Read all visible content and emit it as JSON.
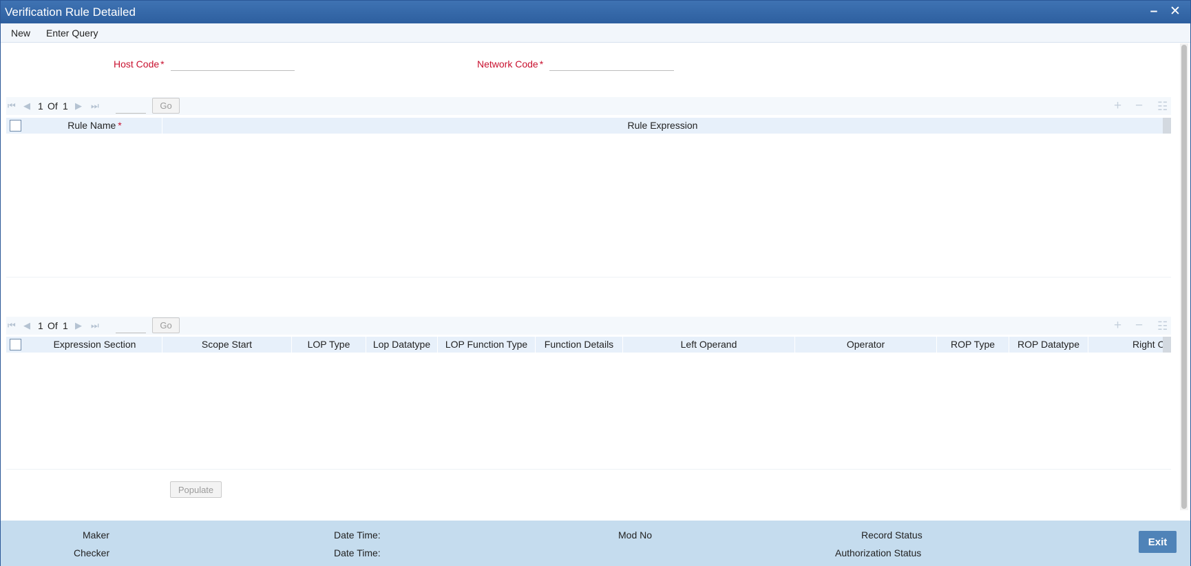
{
  "window": {
    "title": "Verification Rule Detailed",
    "minimize_glyph": "–",
    "close_glyph": "✕"
  },
  "menu": {
    "new_label": "New",
    "enter_query_label": "Enter Query"
  },
  "form": {
    "host_code_label": "Host Code",
    "network_code_label": "Network Code",
    "required_marker": "*",
    "host_code_value": "",
    "network_code_value": ""
  },
  "rules_grid": {
    "current_page": "1",
    "of_label": "Of",
    "total_pages": "1",
    "go_label": "Go",
    "columns": [
      "Rule Name",
      "Rule Expression"
    ],
    "required_marker": "*",
    "rows": []
  },
  "expression_grid": {
    "current_page": "1",
    "of_label": "Of",
    "total_pages": "1",
    "go_label": "Go",
    "columns": [
      "Expression Section",
      "Scope Start",
      "LOP Type",
      "Lop Datatype",
      "LOP Function Type",
      "Function Details",
      "Left Operand",
      "Operator",
      "ROP Type",
      "ROP Datatype",
      "Right Operand"
    ],
    "rows": []
  },
  "actions": {
    "populate_label": "Populate"
  },
  "footer": {
    "maker_label": "Maker",
    "checker_label": "Checker",
    "date_time_label": "Date Time:",
    "mod_no_label": "Mod No",
    "record_status_label": "Record Status",
    "authorization_status_label": "Authorization Status",
    "exit_label": "Exit"
  },
  "icons": {
    "first_page": "first-page-icon",
    "prev_page": "prev-page-icon",
    "next_page": "next-page-icon",
    "last_page": "last-page-icon",
    "add_row": "plus-icon",
    "delete_row": "minus-icon",
    "single_view": "list-view-icon"
  },
  "colors": {
    "title_bar": "#2d5f9f",
    "required_label": "#c8102e",
    "footer_bg": "#c5dcee",
    "exit_button": "#4f83b8",
    "grid_header": "#e7f0fa"
  }
}
